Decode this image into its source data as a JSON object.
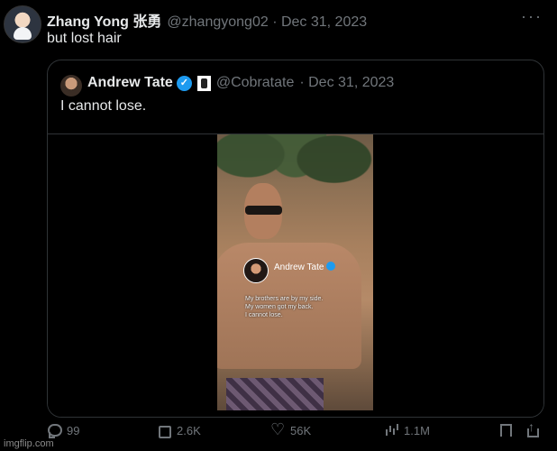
{
  "post": {
    "author_name": "Zhang Yong 张勇",
    "author_handle": "@zhangyong02",
    "author_date": "· Dec 31, 2023",
    "text": "but lost hair",
    "more_label": "···"
  },
  "quote": {
    "author_name": "Andrew Tate",
    "author_handle": "@Cobratate",
    "date": "· Dec 31, 2023",
    "text": "I cannot lose.",
    "video_overlay": {
      "name": "Andrew Tate",
      "lines": [
        "My brothers are by my side.",
        "My women got my back.",
        "I cannot lose."
      ]
    }
  },
  "actions": {
    "replies": "99",
    "reposts": "2.6K",
    "likes": "56K",
    "views": "1.1M"
  },
  "watermark": "imgflip.com",
  "icons": [
    "reply-icon",
    "retweet-icon",
    "like-icon",
    "views-icon",
    "bookmark-icon",
    "share-icon",
    "verified-badge-icon"
  ],
  "colors": {
    "background": "#000000",
    "text": "#e7e9ea",
    "muted": "#71767b",
    "accent": "#1d9bf0"
  }
}
